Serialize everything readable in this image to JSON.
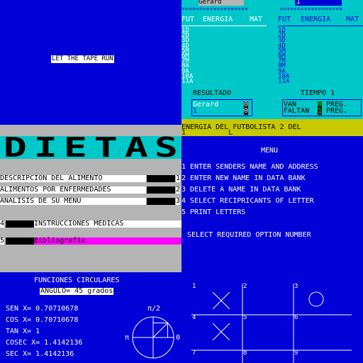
{
  "tape_screen": {
    "message": "LET THE TAPE RUN"
  },
  "football": {
    "player_left": "Gerard",
    "player_right": "1",
    "stars_left": "*******************",
    "stars_right": "******************",
    "headers": [
      "FUT",
      "ENERGIA",
      "MAT"
    ],
    "left_list": [
      "1D",
      "2D",
      "3D",
      "4D",
      "5M",
      "6M",
      "7M",
      "8A",
      "9A",
      "10A",
      "11A"
    ],
    "right_list": [
      "1D",
      "2D",
      "3D",
      "4D",
      "5M",
      "6M",
      "7M",
      "8M",
      "9A",
      "10A",
      "11A"
    ],
    "resultado_label": "RESULTADO",
    "tiempo_label": "TIEMPO 1",
    "score_rows": [
      {
        "name": "Gerard",
        "score": "0"
      },
      {
        "name": "1",
        "score": "0"
      }
    ],
    "van_label": "VAN",
    "van_value": "0",
    "van_suffix": "PREG.",
    "faltan_label": "FALTAN",
    "faltan_value": "1",
    "faltan_suffix": "PREG."
  },
  "energy_prompt": {
    "line1": "ENERGIA DEL FUTBOLISTA 2 DEL",
    "line2": "1          L"
  },
  "dietas": {
    "title": "DIETAS",
    "options": [
      {
        "label": "DESCRIPCION DEL ALIMENTO",
        "number": "1"
      },
      {
        "label": "ALIMENTOS POR ENFERMEDADES",
        "number": "2"
      },
      {
        "label": "ANALISIS DE SU MENU",
        "number": "3"
      }
    ],
    "option4": {
      "number": "4",
      "label": "INSTRUCCIONES MEDICAS"
    },
    "option5": {
      "number": "5",
      "label": "Bibliografia"
    },
    "colors": {
      "title_block": "#00c8c8",
      "magenta": "#ff00ff"
    }
  },
  "letters_menu": {
    "title": "MENU",
    "items": [
      "1 ENTER SENDERS NAME AND ADDRESS",
      "2 ENTER NEW NAME IN DATA BANK",
      "3 DELETE A NAME IN DATA BANK",
      "4 SELECT RECIPRICANTS OF LETTER",
      "5 PRINT LETTERS"
    ],
    "prompt": "SELECT REQUIRED OPTION NUMBER"
  },
  "circular": {
    "title": "FUNCIONES CIRCULARES",
    "angle": "ANGULO= 45 grados",
    "rows": [
      "SEN X= 0.70710678",
      "COS X= 0.70710678",
      "TAN X= 1",
      "COSEC X= 1.4142136",
      "SEC X= 1.4142136"
    ],
    "label_top": "π/2",
    "label_left": "π",
    "label_right": "0"
  },
  "tictactoe": {
    "cells": [
      {
        "num": "1",
        "mark": "X"
      },
      {
        "num": "2",
        "mark": ""
      },
      {
        "num": "3",
        "mark": "O"
      },
      {
        "num": "4",
        "mark": "X"
      },
      {
        "num": "5",
        "mark": ""
      },
      {
        "num": "6",
        "mark": ""
      },
      {
        "num": "7",
        "mark": ""
      },
      {
        "num": "8",
        "mark": ""
      },
      {
        "num": "9",
        "mark": ""
      }
    ]
  }
}
